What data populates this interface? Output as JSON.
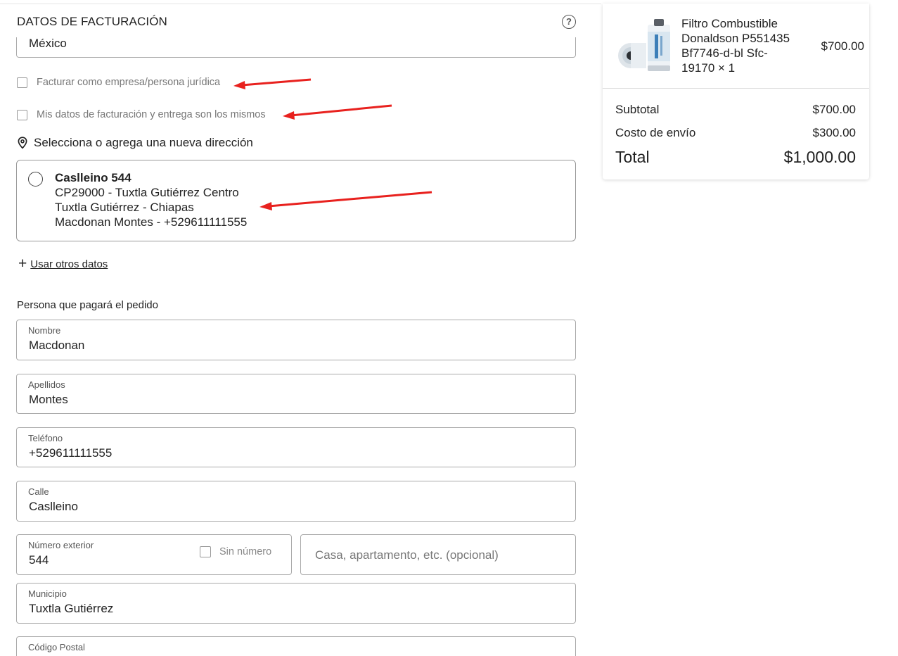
{
  "billing": {
    "title": "DATOS DE FACTURACIÓN",
    "help_icon": "question-circle-icon",
    "country_value": "México",
    "checkbox_company_label": "Facturar como empresa/persona jurídica",
    "checkbox_same_label": "Mis datos de facturación y entrega son los mismos"
  },
  "address": {
    "heading": "Selecciona o agrega una nueva dirección",
    "heading_icon": "location-pin-icon",
    "card": {
      "name": "Caslleino 544",
      "line1": "CP29000 - Tuxtla Gutiérrez Centro",
      "line2": "Tuxtla Gutiérrez - Chiapas",
      "line3": "Macdonan Montes - +529611111555"
    },
    "use_other_label": "Usar otros datos"
  },
  "payer": {
    "title": "Persona que pagará el pedido",
    "nombre_label": "Nombre",
    "nombre_value": "Macdonan",
    "apellidos_label": "Apellidos",
    "apellidos_value": "Montes",
    "telefono_label": "Teléfono",
    "telefono_value": "+529611111555",
    "calle_label": "Calle",
    "calle_value": "Caslleino",
    "numero_label": "Número exterior",
    "numero_value": "544",
    "sin_numero_label": "Sin número",
    "interior_placeholder": "Casa, apartamento, etc. (opcional)",
    "municipio_label": "Municipio",
    "municipio_value": "Tuxtla Gutiérrez",
    "cp_label": "Código Postal"
  },
  "summary": {
    "product_name": "Filtro Combustible Donaldson P551435 Bf7746-d-bl Sfc-19170 × 1",
    "product_price": "$700.00",
    "subtotal_label": "Subtotal",
    "subtotal_value": "$700.00",
    "shipping_label": "Costo de envío",
    "shipping_value": "$300.00",
    "total_label": "Total",
    "total_value": "$1,000.00"
  },
  "colors": {
    "annotation_arrow": "#e8211e",
    "border": "#aaaaaa",
    "text": "#222222"
  }
}
